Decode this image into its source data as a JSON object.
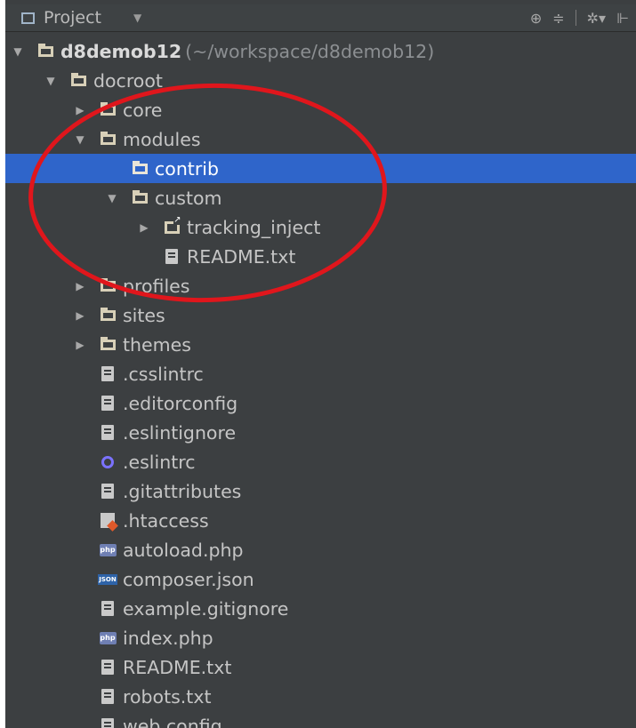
{
  "toolbar": {
    "title": "Project"
  },
  "tree": {
    "root_name": "d8demob12",
    "root_path": "(~/workspace/d8demob12)",
    "docroot": "docroot",
    "core": "core",
    "modules": "modules",
    "contrib": "contrib",
    "custom": "custom",
    "tracking": "tracking_inject",
    "module_readme": "README.txt",
    "profiles": "profiles",
    "sites": "sites",
    "themes": "themes",
    "files": [
      ".csslintrc",
      ".editorconfig",
      ".eslintignore",
      ".eslintrc",
      ".gitattributes",
      ".htaccess",
      "autoload.php",
      "composer.json",
      "example.gitignore",
      "index.php",
      "README.txt",
      "robots.txt",
      "web.config"
    ]
  },
  "colors": {
    "selection": "#2f65ca",
    "annotation": "#e0161c",
    "panel": "#3c3f41"
  }
}
